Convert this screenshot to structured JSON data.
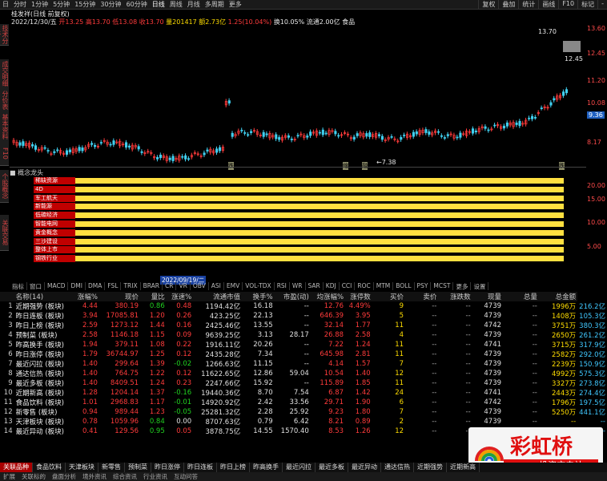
{
  "toolbar": {
    "timeframes": [
      "日",
      "分时",
      "1分钟",
      "5分钟",
      "15分钟",
      "30分钟",
      "60分钟",
      "日线",
      "周线",
      "月线",
      "多周期",
      "更多"
    ],
    "right_buttons": [
      "复权",
      "叠加",
      "统计",
      "画线",
      "F10",
      "标记",
      "-"
    ]
  },
  "chart": {
    "title": "桂发祥(日线 前复权)",
    "date": "2022/12/30/五",
    "open_label": "开",
    "open": "13.25",
    "high_label": "高",
    "high": "13.70",
    "low_label": "低",
    "low": "13.08",
    "close_label": "收",
    "close": "13.70",
    "volume_label": "量",
    "volume": "201417",
    "amount_label": "额",
    "amount": "2.73亿",
    "change": "1.25(10.04%)",
    "turnover_label": "换",
    "turnover": "10.05%",
    "float_label": "流通",
    "float": "2.00亿",
    "sector": "食品",
    "price_axis": [
      "13.70",
      "12.45",
      "11.20",
      "10.08",
      "9.36",
      "8.17",
      "7.38"
    ],
    "right_axis": [
      "13.60",
      "12.45",
      "11.20",
      "10.08",
      "9.36",
      "8.17",
      "7.38"
    ],
    "marker_high": "13.70",
    "marker_low": "7.38",
    "date_tag": "2022/09/19/二",
    "note_labels": [
      "跌",
      "缩",
      "融",
      "跌"
    ]
  },
  "indicator": {
    "title": "概念龙头",
    "labels": [
      "稀缺资源",
      "4D",
      "军工航天",
      "新能源",
      "低碳经济",
      "智能电网",
      "黄金概念",
      "三沙建设",
      "整体上市",
      "钢铁行业"
    ],
    "axis": [
      "20.00",
      "15.00",
      "10.00",
      "5.00"
    ],
    "tabs": [
      "指标",
      "窗口",
      "MACD",
      "DMI",
      "DMA",
      "FSL",
      "TRIX",
      "BRAR",
      "CR",
      "VR",
      "OBV",
      "ASI",
      "EMV",
      "VOL-TDX",
      "RSI",
      "WR",
      "SAR",
      "KDJ",
      "CCI",
      "ROC",
      "MTM",
      "BOLL",
      "PSY",
      "MCST",
      "更多",
      "设置"
    ]
  },
  "table": {
    "headers": [
      "名称(14)",
      "涨幅%",
      "现价",
      "量比",
      "涨速%",
      "流通市值",
      "换手%",
      "市盈(动)",
      "均涨幅%",
      "涨停数",
      "买价",
      "卖价",
      "涨跌数",
      "现量",
      "总量",
      "总金额"
    ],
    "rows": [
      [
        "1",
        "近期强势",
        "(板块)",
        "4.44",
        "380.19",
        "0.86",
        "0.48",
        "1194.42亿",
        "16.18",
        "--",
        "12.76",
        "4.49%",
        "9",
        "--",
        "--",
        "4739",
        "--",
        "1996万",
        "216.2亿"
      ],
      [
        "2",
        "昨日连板",
        "(板块)",
        "3.94",
        "17085.81",
        "1.20",
        "0.26",
        "423.25亿",
        "22.13",
        "--",
        "646.39",
        "3.95",
        "5",
        "--",
        "--",
        "4739",
        "--",
        "1408万",
        "105.3亿"
      ],
      [
        "3",
        "昨日上榜",
        "(板块)",
        "2.59",
        "1273.12",
        "1.44",
        "0.16",
        "2425.46亿",
        "13.55",
        "--",
        "32.14",
        "1.77",
        "11",
        "--",
        "--",
        "4742",
        "--",
        "3751万",
        "380.3亿"
      ],
      [
        "4",
        "预制菜",
        "(板块)",
        "2.58",
        "1146.18",
        "1.15",
        "0.09",
        "9639.25亿",
        "3.13",
        "28.17",
        "26.88",
        "2.58",
        "4",
        "--",
        "--",
        "4739",
        "--",
        "2650万",
        "261.2亿"
      ],
      [
        "5",
        "昨高换手",
        "(板块)",
        "1.94",
        "379.11",
        "1.08",
        "0.22",
        "1916.11亿",
        "20.26",
        "--",
        "7.22",
        "1.24",
        "11",
        "--",
        "--",
        "4741",
        "--",
        "3715万",
        "317.9亿"
      ],
      [
        "6",
        "昨日涨停",
        "(板块)",
        "1.79",
        "36744.97",
        "1.25",
        "0.12",
        "2435.28亿",
        "7.34",
        "--",
        "645.98",
        "2.81",
        "11",
        "--",
        "--",
        "4739",
        "--",
        "2582万",
        "292.0亿"
      ],
      [
        "7",
        "最近闪拉",
        "(板块)",
        "1.40",
        "299.64",
        "1.39",
        "-0.02",
        "1266.63亿",
        "11.15",
        "--",
        "4.14",
        "1.57",
        "7",
        "--",
        "--",
        "4739",
        "--",
        "2239万",
        "150.9亿"
      ],
      [
        "8",
        "通达信热",
        "(板块)",
        "1.40",
        "764.75",
        "1.22",
        "0.12",
        "11622.65亿",
        "12.86",
        "59.04",
        "10.54",
        "1.40",
        "12",
        "--",
        "--",
        "4739",
        "--",
        "4992万",
        "575.3亿"
      ],
      [
        "9",
        "最近多板",
        "(板块)",
        "1.40",
        "8409.51",
        "1.24",
        "0.23",
        "2247.66亿",
        "15.92",
        "--",
        "115.89",
        "1.85",
        "11",
        "--",
        "--",
        "4739",
        "--",
        "3327万",
        "273.8亿"
      ],
      [
        "10",
        "近期新高",
        "(板块)",
        "1.28",
        "1204.14",
        "1.37",
        "-0.16",
        "19440.36亿",
        "8.70",
        "7.54",
        "6.87",
        "1.42",
        "24",
        "--",
        "--",
        "4741",
        "--",
        "2443万",
        "274.4亿"
      ],
      [
        "11",
        "食品饮料",
        "(板块)",
        "1.01",
        "2968.83",
        "1.17",
        "-0.01",
        "14920.92亿",
        "2.42",
        "33.56",
        "29.71",
        "1.90",
        "6",
        "--",
        "--",
        "4742",
        "--",
        "1796万",
        "197.5亿"
      ],
      [
        "12",
        "新零售",
        "(板块)",
        "0.94",
        "989.44",
        "1.23",
        "-0.05",
        "25281.32亿",
        "2.28",
        "25.92",
        "9.23",
        "1.80",
        "7",
        "--",
        "--",
        "4739",
        "--",
        "5250万",
        "441.1亿"
      ],
      [
        "13",
        "天津板块",
        "(板块)",
        "0.78",
        "1059.96",
        "0.84",
        "0.00",
        "8707.63亿",
        "0.79",
        "6.42",
        "8.21",
        "0.89",
        "2",
        "--",
        "--",
        "4739",
        "--",
        "--",
        "--"
      ],
      [
        "14",
        "最近异动",
        "(板块)",
        "0.41",
        "129.56",
        "0.95",
        "0.05",
        "3878.75亿",
        "14.55",
        "1570.40",
        "8.53",
        "1.26",
        "12",
        "--",
        "--",
        "4739",
        "--",
        "--",
        "--"
      ]
    ]
  },
  "bottom_tabs": [
    "关联品种",
    "食品饮料",
    "天津板块",
    "新零售",
    "预制菜",
    "昨日涨停",
    "昨日连板",
    "昨日上榜",
    "昨高换手",
    "最近闪拉",
    "最近多板",
    "最近异动",
    "通达信热",
    "近期强势",
    "近期新高"
  ],
  "status": [
    "扩展",
    "关联标的",
    "盘面分析",
    "境外资讯",
    "综合资讯",
    "行业资讯",
    "互动问答"
  ],
  "colors": {
    "up": "#ff3b3b",
    "down": "#20d020",
    "accent": "#ffdd00",
    "label_bg": "#c00000"
  },
  "watermark": {
    "brand": "彩虹桥",
    "slogan": "投资充电站"
  }
}
